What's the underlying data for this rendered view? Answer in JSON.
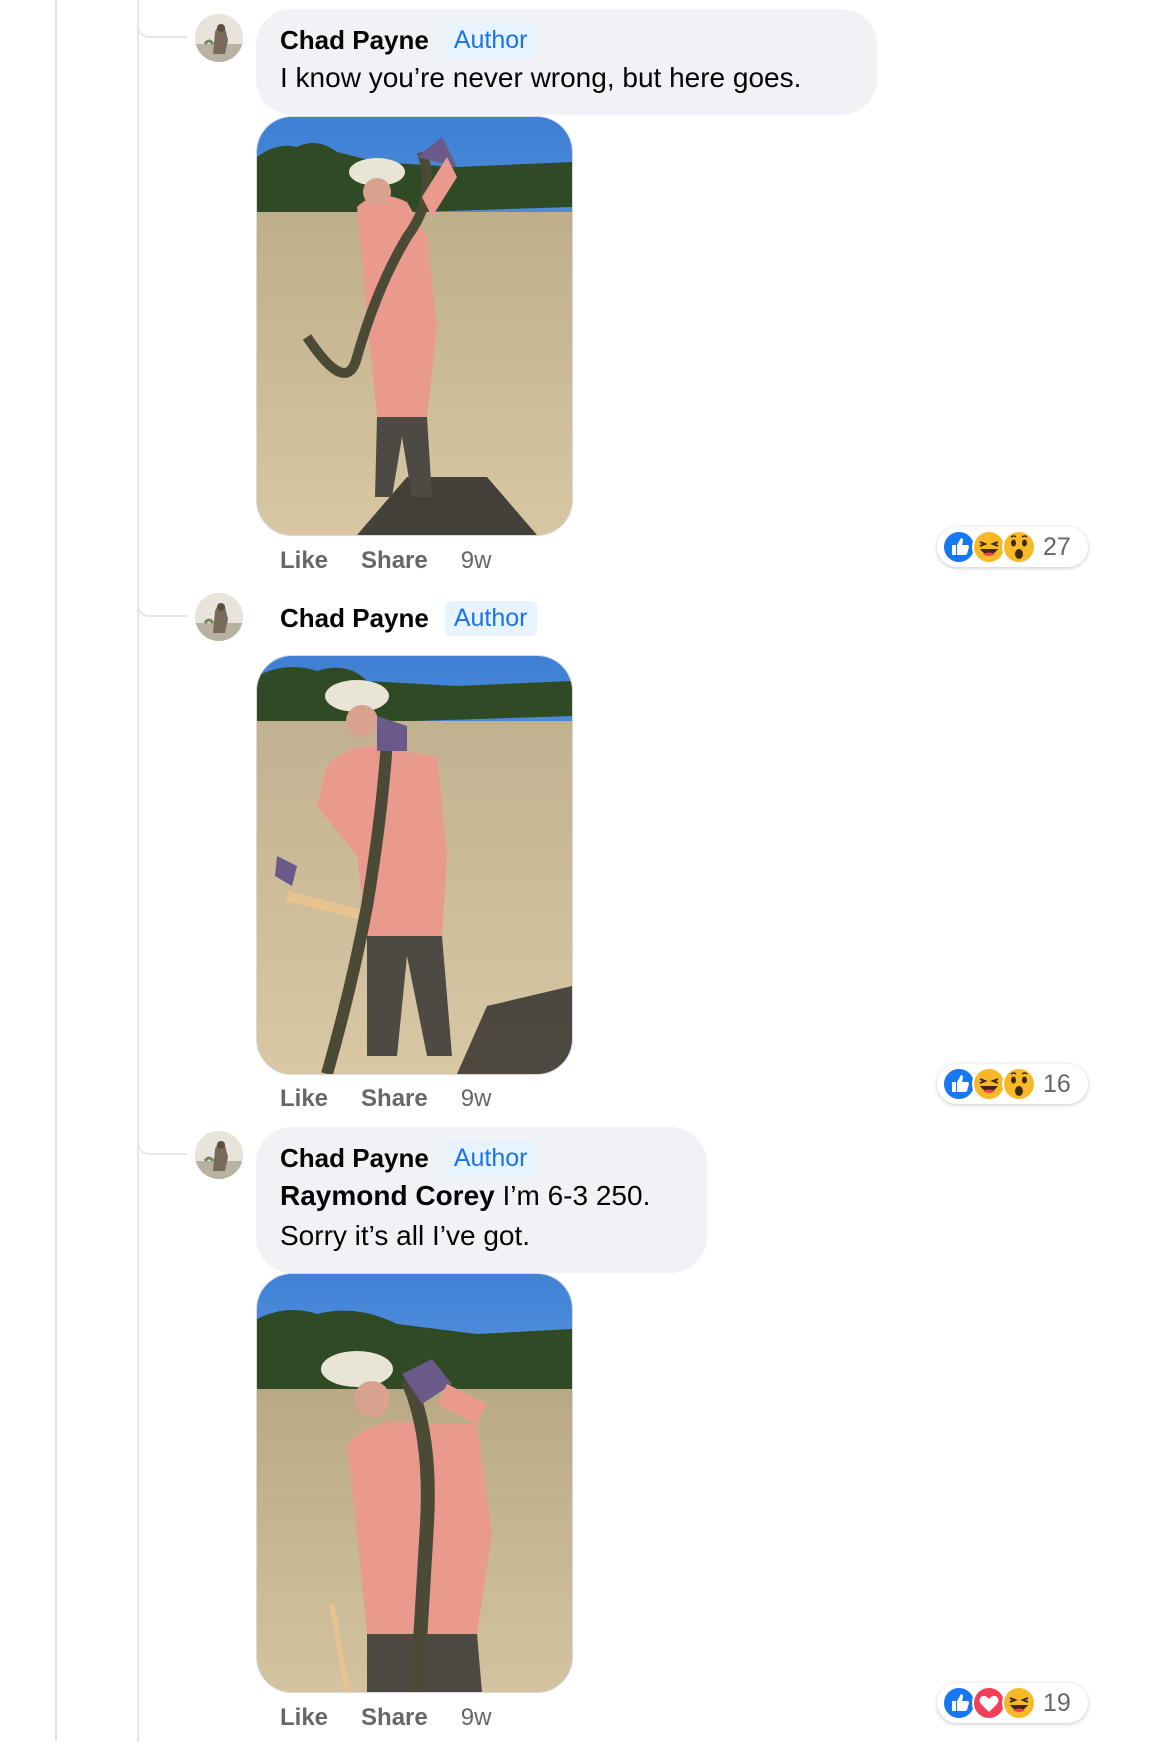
{
  "comments": [
    {
      "author": "Chad Payne",
      "badge": "Author",
      "text": "I know you’re never wrong, but here goes.",
      "actions": {
        "like": "Like",
        "share": "Share",
        "time": "9w"
      },
      "reactions": {
        "icons": [
          "like-reaction",
          "haha-reaction",
          "wow-reaction"
        ],
        "count": "27"
      }
    },
    {
      "author": "Chad Payne",
      "badge": "Author",
      "actions": {
        "like": "Like",
        "share": "Share",
        "time": "9w"
      },
      "reactions": {
        "icons": [
          "like-reaction",
          "haha-reaction",
          "wow-reaction"
        ],
        "count": "16"
      }
    },
    {
      "author": "Chad Payne",
      "badge": "Author",
      "mention": "Raymond Corey",
      "text": " I’m 6-3 250.",
      "text_line2": "Sorry it’s all I’ve got.",
      "actions": {
        "like": "Like",
        "share": "Share",
        "time": "9w"
      },
      "reactions": {
        "icons": [
          "like-reaction",
          "love-reaction",
          "haha-reaction"
        ],
        "count": "19"
      }
    }
  ],
  "colors": {
    "accent": "#1b74e4",
    "badge_bg": "#e7f3ff",
    "bubble_bg": "#f0f2f5",
    "secondary_text": "#65676b",
    "like": "#1877f2",
    "love": "#f33e58",
    "emoji": "#f7b928"
  }
}
